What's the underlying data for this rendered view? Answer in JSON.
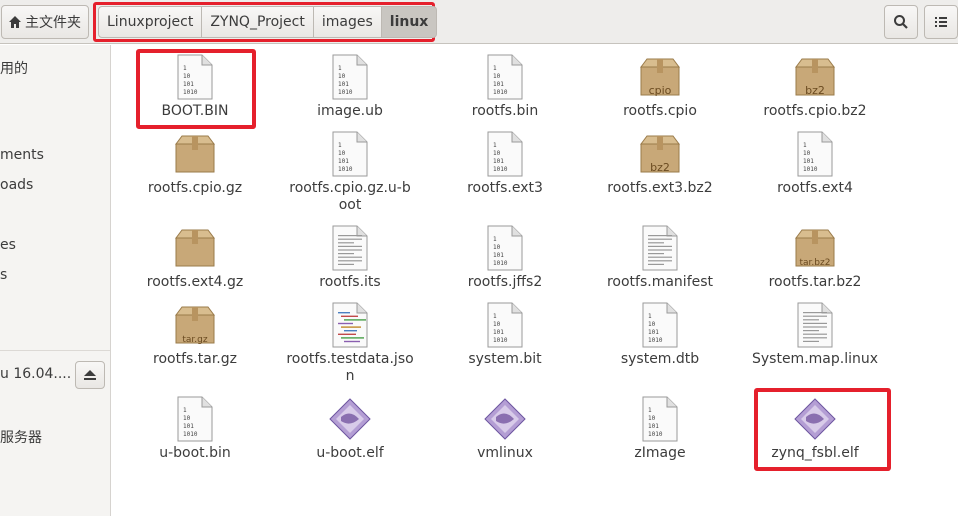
{
  "header": {
    "home_label": "主文件夹",
    "breadcrumbs": [
      "Linuxproject",
      "ZYNQ_Project",
      "images",
      "linux"
    ],
    "search_icon": "search-icon",
    "menu_icon": "menu-icon"
  },
  "sidebar": {
    "items": [
      {
        "label": "用的"
      },
      {
        "label": "ments"
      },
      {
        "label": "oads"
      },
      {
        "label": "es"
      },
      {
        "label": "s"
      },
      {
        "label": "u 16.04...."
      },
      {
        "label": "服务器"
      }
    ]
  },
  "files": [
    {
      "name": "BOOT.BIN",
      "icon": "binary-file-icon"
    },
    {
      "name": "image.ub",
      "icon": "binary-file-icon"
    },
    {
      "name": "rootfs.bin",
      "icon": "binary-file-icon"
    },
    {
      "name": "rootfs.cpio",
      "icon": "archive-icon",
      "badge": "cpio"
    },
    {
      "name": "rootfs.cpio.bz2",
      "icon": "archive-icon",
      "badge": "bz2"
    },
    {
      "name": "rootfs.cpio.gz",
      "icon": "archive-icon",
      "badge": ""
    },
    {
      "name": "rootfs.cpio.gz.u-boot",
      "icon": "binary-file-icon"
    },
    {
      "name": "rootfs.ext3",
      "icon": "binary-file-icon"
    },
    {
      "name": "rootfs.ext3.bz2",
      "icon": "archive-icon",
      "badge": "bz2"
    },
    {
      "name": "rootfs.ext4",
      "icon": "binary-file-icon"
    },
    {
      "name": "rootfs.ext4.gz",
      "icon": "archive-icon",
      "badge": ""
    },
    {
      "name": "rootfs.its",
      "icon": "text-file-icon"
    },
    {
      "name": "rootfs.jffs2",
      "icon": "binary-file-icon"
    },
    {
      "name": "rootfs.manifest",
      "icon": "text-file-icon"
    },
    {
      "name": "rootfs.tar.bz2",
      "icon": "archive-icon",
      "badge": "tar.bz2"
    },
    {
      "name": "rootfs.tar.gz",
      "icon": "archive-icon",
      "badge": "tar.gz"
    },
    {
      "name": "rootfs.testdata.json",
      "icon": "code-file-icon"
    },
    {
      "name": "system.bit",
      "icon": "binary-file-icon"
    },
    {
      "name": "system.dtb",
      "icon": "binary-file-icon"
    },
    {
      "name": "System.map.linux",
      "icon": "text-file-icon"
    },
    {
      "name": "u-boot.bin",
      "icon": "binary-file-icon"
    },
    {
      "name": "u-boot.elf",
      "icon": "executable-icon"
    },
    {
      "name": "vmlinux",
      "icon": "executable-icon"
    },
    {
      "name": "zImage",
      "icon": "binary-file-icon"
    },
    {
      "name": "zynq_fsbl.elf",
      "icon": "executable-icon"
    }
  ],
  "binary_icon_text": [
    "1",
    "10",
    "101",
    "1010"
  ],
  "colors": {
    "highlight": "#e5202c",
    "archive": "#c8a878",
    "executable": "#8a6fb0"
  }
}
